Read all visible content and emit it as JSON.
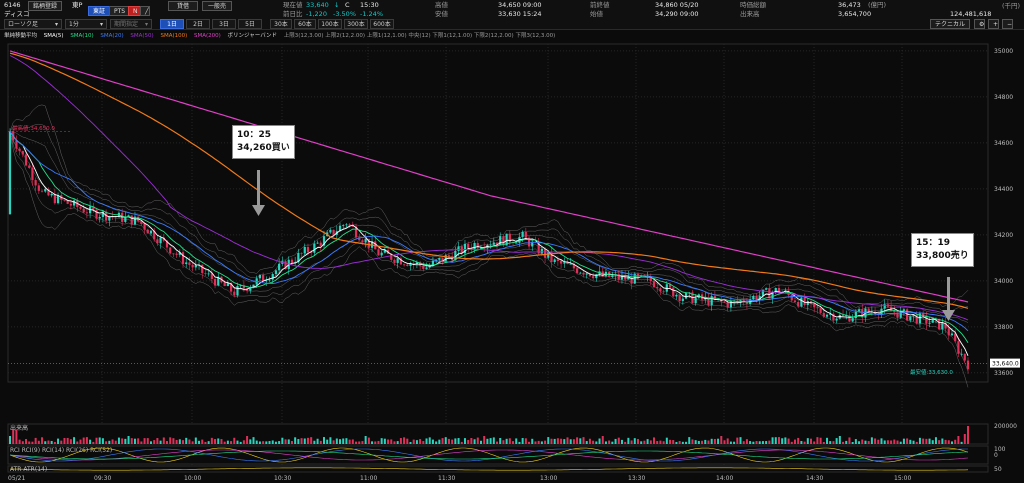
{
  "header": {
    "code": "6146",
    "name": "ディスコ",
    "btn_detail": "銘柄登録",
    "exchange": "東P",
    "btn_tosho": "東証",
    "btn_pts": "PTS",
    "btn_n": "N",
    "btn_credit": "貸借",
    "btn_general": "一般売",
    "now_label": "現在値",
    "now_value": "33,640",
    "now_arrow": "↓",
    "now_c": "C",
    "now_time": "15:30",
    "prev_label": "前日比",
    "prev_value": "-1,220",
    "prev_pct": "-3.50%",
    "prev_pct2": "-1.24%",
    "high_label": "高値",
    "high_value": "34,650 09:00",
    "low_label": "安値",
    "low_value": "33,630 15:24",
    "prevclose_label": "前終値",
    "prevclose_value": "34,860 05/20",
    "open_label": "始値",
    "open_value": "34,290 09:00",
    "mktcap_label": "時価総額",
    "mktcap_value": "36,473",
    "mktcap_unit": "(億円)",
    "volume_label": "出来高",
    "volume_value": "3,654,700",
    "turnover_value": "124,481,618",
    "turnover_unit": "(千円)",
    "technical_btn": "テクニカル"
  },
  "toolbar": {
    "chart_type": "ローソク足",
    "interval": "1分",
    "period_placeholder": "期間指定",
    "tf_buttons": [
      "1日",
      "2日",
      "3日",
      "5日"
    ],
    "bar_buttons": [
      "30本",
      "60本",
      "100本",
      "300本",
      "600本"
    ]
  },
  "legend": {
    "title": "単純移動平均",
    "sma5": "SMA(5)",
    "sma10": "SMA(10)",
    "sma20": "SMA(20)",
    "sma50": "SMA(50)",
    "sma100": "SMA(100)",
    "sma200": "SMA(200)",
    "bb": "ボリンジャーバンド",
    "bb_items": "上限3(12,3.00)  上限2(12,2.00)  上限1(12,1.00)  中央(12)  下限1(12,1.00)  下限2(12,2.00)  下限3(12,3.00)"
  },
  "colors": {
    "sma5": "#ffffff",
    "sma10": "#22e08a",
    "sma20": "#3a7bff",
    "sma50": "#9b2fd6",
    "sma100": "#f07a1a",
    "sma200": "#e040c8",
    "bb": "#8a8a8a",
    "up": "#2ad5c0",
    "down": "#e0305a"
  },
  "callouts": {
    "buy_time": "10：25",
    "buy_text": "34,260買い",
    "sell_time": "15：19",
    "sell_text": "33,800売り"
  },
  "chart_markers": {
    "high_marker": "最高値:34,650.0",
    "low_marker": "最安値:33,630.0",
    "last_price": "33,640.0"
  },
  "panels": {
    "volume_label": "出来高",
    "rci_label": "RCI",
    "rci_items": "RCI(9)  RCI(14)  RCI(26)  RCI(52)",
    "atr_label": "ATR",
    "atr_item": "ATR(14)",
    "volume_tick": "200000",
    "rci_tick_top": "100",
    "rci_tick_mid": "0",
    "atr_tick": "50"
  },
  "chart_data": {
    "type": "candlestick",
    "y_ticks": [
      "35000",
      "34800",
      "34600",
      "34400",
      "34200",
      "34000",
      "33800",
      "33600"
    ],
    "ylim": [
      33560,
      35030
    ],
    "x_ticks": [
      "09:30",
      "10:00",
      "10:30",
      "11:00",
      "11:30",
      "13:00",
      "13:30",
      "14:00",
      "14:30",
      "15:00"
    ],
    "date_label": "05/21"
  }
}
